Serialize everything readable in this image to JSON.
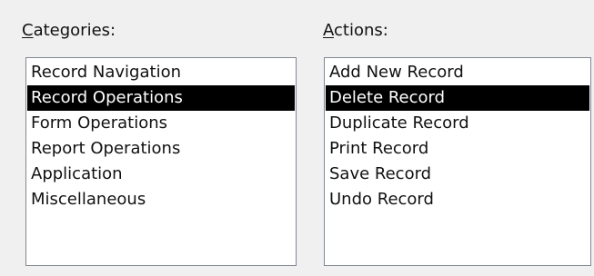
{
  "categories": {
    "label_accel": "C",
    "label_rest": "ategories:",
    "items": [
      "Record Navigation",
      "Record Operations",
      "Form Operations",
      "Report Operations",
      "Application",
      "Miscellaneous"
    ],
    "selected": "Record Operations"
  },
  "actions": {
    "label_accel": "A",
    "label_rest": "ctions:",
    "items": [
      "Add New Record",
      "Delete Record",
      "Duplicate Record",
      "Print Record",
      "Save Record",
      "Undo Record"
    ],
    "selected": "Delete Record"
  }
}
